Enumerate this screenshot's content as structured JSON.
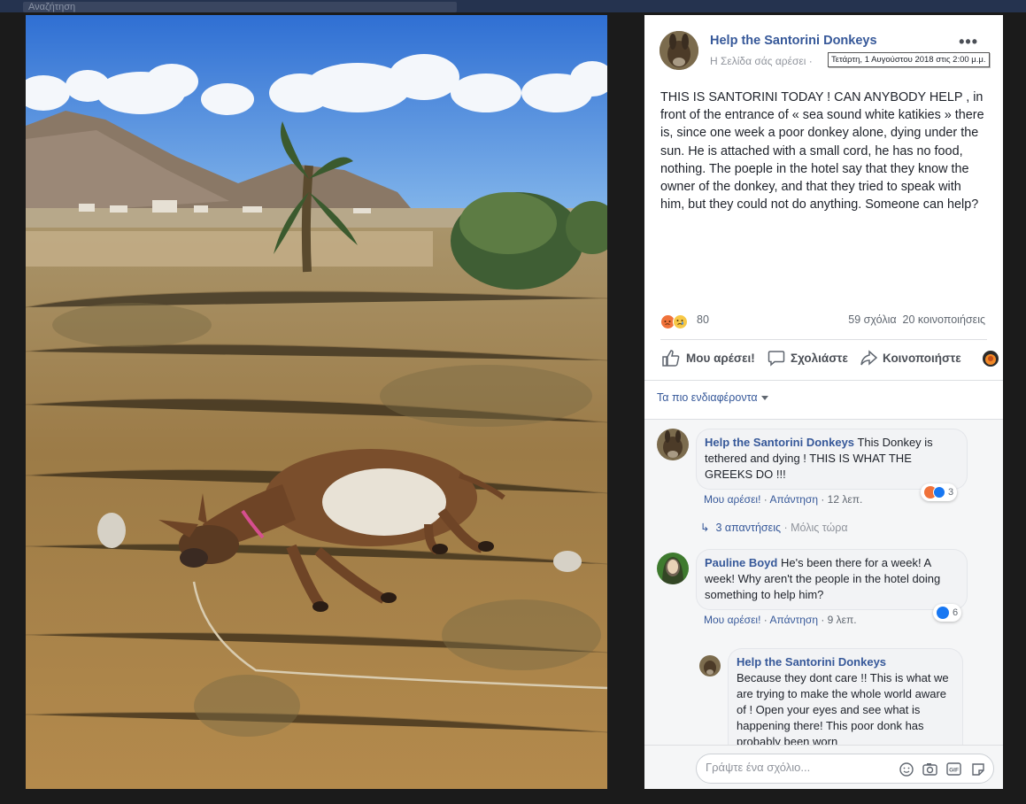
{
  "topbar": {
    "search_placeholder": "Αναζήτηση"
  },
  "photo": {
    "subject": "donkey lying on dry grass, mountains and palm trees, Santorini"
  },
  "post": {
    "page_name": "Help the Santorini Donkeys",
    "page_sub": "Η Σελίδα σάς αρέσει ·",
    "timestamp_tooltip": "Τετάρτη, 1 Αυγούστου 2018 στις 2:00 μ.μ.",
    "text": "THIS IS SANTORINI TODAY ! CAN ANYBODY HELP , in front of the entrance of « sea sound white katikies » there is, since one week a poor donkey alone, dying under the sun. He is attached with a small cord, he has no food, nothing. The poeple in the hotel say that they know the owner of the donkey, and that they tried to speak with him, but they could not do anything. Someone can help?",
    "reaction_count": "80",
    "comments_count": "59 σχόλια",
    "shares_count": "20 κοινοποιήσεις"
  },
  "actions": {
    "like": "Μου αρέσει!",
    "comment": "Σχολιάστε",
    "share": "Κοινοποιήστε"
  },
  "sort": {
    "label": "Τα πιο ενδιαφέροντα"
  },
  "comments": [
    {
      "author": "Help the Santorini Donkeys",
      "text": "This Donkey is tethered and dying ! THIS IS WHAT THE GREEKS DO !!!",
      "like": "Μου αρέσει!",
      "reply": "Απάντηση",
      "time": "12 λεπ.",
      "reaction_count": "3",
      "replies_label": "3 απαντήσεις",
      "replies_time": "· Μόλις τώρα"
    },
    {
      "author": "Pauline Boyd",
      "text": "He's been there for a week! A week! Why aren't the people in the hotel doing something to help him?",
      "like": "Μου αρέσει!",
      "reply": "Απάντηση",
      "time": "9 λεπ.",
      "reaction_count": "6"
    },
    {
      "author": "Help the Santorini Donkeys",
      "text": "Because they dont care !! This is what we are trying to make the whole world aware of ! Open your eyes and see what is happening there! This poor donk has probably been worn"
    }
  ],
  "composer": {
    "placeholder": "Γράψτε ένα σχόλιο..."
  },
  "colors": {
    "link_blue": "#365899",
    "like_blue": "#1877f2",
    "angry_orange": "#f0723a"
  }
}
